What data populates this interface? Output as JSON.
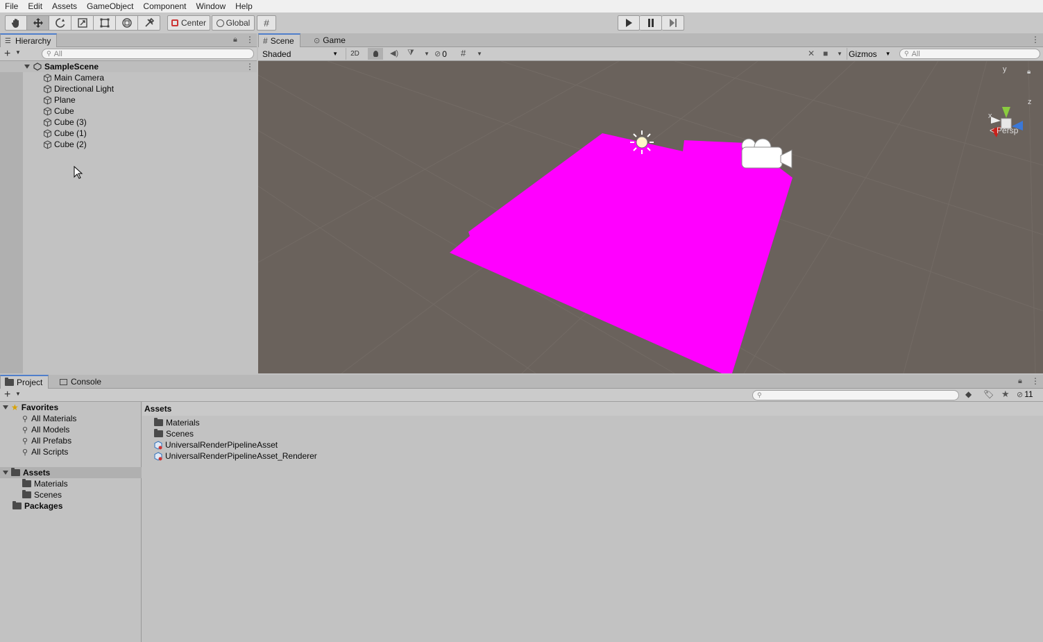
{
  "menu": [
    "File",
    "Edit",
    "Assets",
    "GameObject",
    "Component",
    "Window",
    "Help"
  ],
  "toolbar": {
    "tools": [
      "hand-tool-icon",
      "move-tool-icon",
      "rotate-tool-icon",
      "scale-tool-icon",
      "rect-tool-icon",
      "transform-tool-icon",
      "custom-tool-icon"
    ],
    "pivot_label": "Center",
    "space_label": "Global"
  },
  "hierarchy": {
    "tab_label": "Hierarchy",
    "search_placeholder": "All",
    "scene_name": "SampleScene",
    "items": [
      "Main Camera",
      "Directional Light",
      "Plane",
      "Cube",
      "Cube (3)",
      "Cube (1)",
      "Cube (2)"
    ]
  },
  "scene_view": {
    "tabs": [
      "Scene",
      "Game"
    ],
    "shading_mode": "Shaded",
    "mode_2d": "2D",
    "hidden_count": "0",
    "gizmos_label": "Gizmos",
    "search_placeholder": "All",
    "axis_labels": {
      "y": "y",
      "z": "z",
      "x": "x"
    },
    "projection_label": "Persp",
    "plane_color": "#ff00ff",
    "background_color": "#6a625c"
  },
  "project": {
    "tabs": [
      "Project",
      "Console"
    ],
    "favorites_label": "Favorites",
    "favorites": [
      "All Materials",
      "All Models",
      "All Prefabs",
      "All Scripts"
    ],
    "assets_label": "Assets",
    "asset_folders": [
      "Materials",
      "Scenes"
    ],
    "packages_label": "Packages",
    "breadcrumb": "Assets",
    "assets_content": [
      "Materials",
      "Scenes",
      "UniversalRenderPipelineAsset",
      "UniversalRenderPipelineAsset_Renderer"
    ],
    "hidden_count": "11"
  }
}
